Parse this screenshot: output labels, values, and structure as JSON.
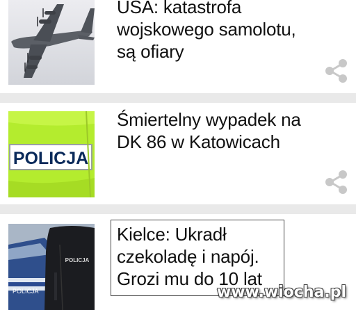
{
  "articles": [
    {
      "headline_lines": [
        "USA: katastrofa",
        "wojskowego samolotu,",
        "są ofiary"
      ],
      "thumbnail": "military-plane-photo",
      "share_icon": "share-icon"
    },
    {
      "headline_lines": [
        "Śmiertelny wypadek na",
        "DK 86 w Katowicach"
      ],
      "thumbnail": "police-vest-photo",
      "thumbnail_text": "POLICJA",
      "share_icon": "share-icon"
    },
    {
      "headline_lines": [
        "Kielce: Ukradł",
        "czekoladę i napój.",
        "Grozi mu do 10 lat"
      ],
      "thumbnail": "police-officer-photo",
      "thumbnail_text": "POLICJA"
    }
  ],
  "watermark": "www.wiocha.pl",
  "colors": {
    "background": "#e9e9e9",
    "card": "#ffffff",
    "share_icon": "#c8c8c8",
    "vest": "#b9f034"
  }
}
